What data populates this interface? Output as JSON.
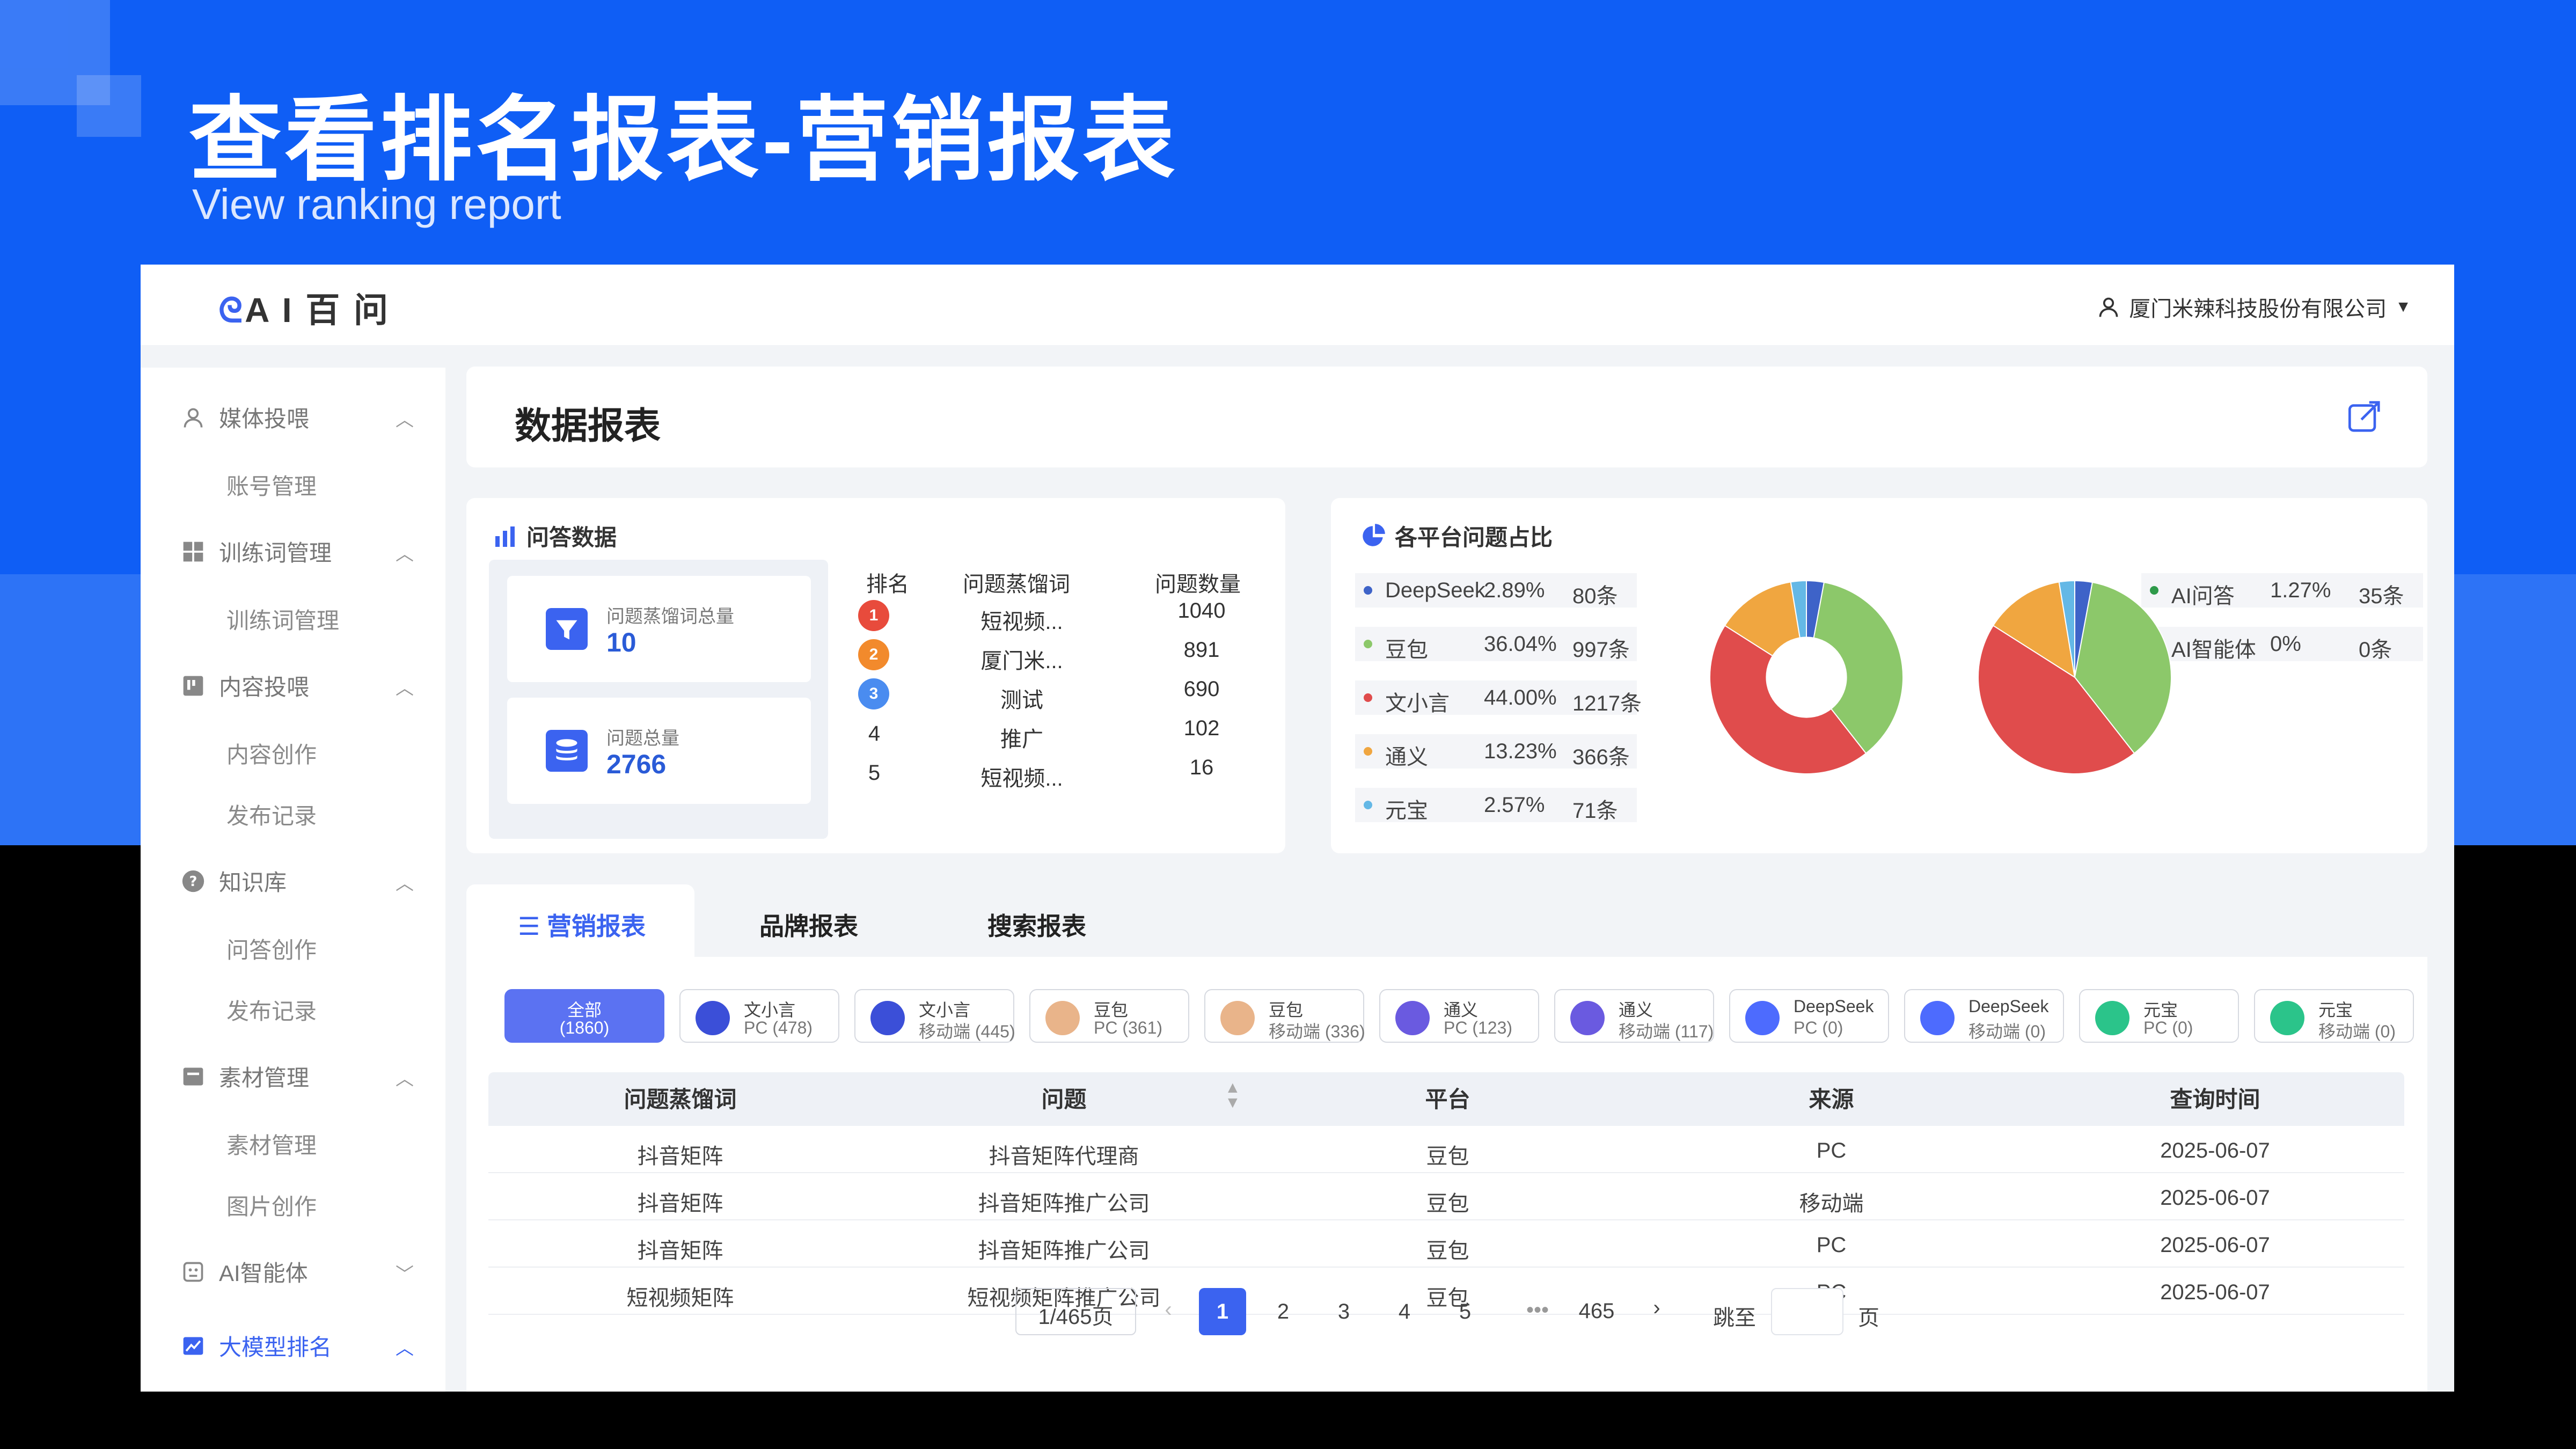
{
  "slide": {
    "title": "查看排名报表-营销报表",
    "subtitle": "View ranking report"
  },
  "app": {
    "logo_mark": "ᘓ",
    "logo_text": "A I 百 问",
    "company": "厦门米辣科技股份有限公司"
  },
  "sidebar": {
    "groups": [
      {
        "label": "媒体投喂",
        "icon": "user-icon",
        "items": [
          "账号管理"
        ]
      },
      {
        "label": "训练词管理",
        "icon": "grid-icon",
        "items": [
          "训练词管理"
        ]
      },
      {
        "label": "内容投喂",
        "icon": "board-icon",
        "items": [
          "内容创作",
          "发布记录"
        ]
      },
      {
        "label": "知识库",
        "icon": "question-icon",
        "items": [
          "问答创作",
          "发布记录"
        ]
      },
      {
        "label": "素材管理",
        "icon": "folder-icon",
        "items": [
          "素材管理",
          "图片创作"
        ]
      },
      {
        "label": "AI智能体",
        "icon": "robot-icon",
        "items": []
      },
      {
        "label": "大模型排名",
        "icon": "chart-icon",
        "items": [],
        "active": true
      }
    ]
  },
  "header": {
    "title": "数据报表"
  },
  "qa": {
    "title": "问答数据",
    "stats": [
      {
        "label": "问题蒸馏词总量",
        "value": "10"
      },
      {
        "label": "问题总量",
        "value": "2766"
      }
    ],
    "columns": [
      "排名",
      "问题蒸馏词",
      "问题数量"
    ],
    "rows": [
      {
        "rank": "1",
        "word": "短视频...",
        "count": "1040"
      },
      {
        "rank": "2",
        "word": "厦门米...",
        "count": "891"
      },
      {
        "rank": "3",
        "word": "测试",
        "count": "690"
      },
      {
        "rank": "4",
        "word": "推广",
        "count": "102"
      },
      {
        "rank": "5",
        "word": "短视频...",
        "count": "16"
      }
    ]
  },
  "platform": {
    "title": "各平台问题占比",
    "legend": [
      {
        "name": "DeepSeek",
        "pct": "2.89%",
        "count": "80条",
        "color": "#3e63c8"
      },
      {
        "name": "豆包",
        "pct": "36.04%",
        "count": "997条",
        "color": "#8cc86a"
      },
      {
        "name": "文小言",
        "pct": "44.00%",
        "count": "1217条",
        "color": "#e04c4c"
      },
      {
        "name": "通义",
        "pct": "13.23%",
        "count": "366条",
        "color": "#f0a640"
      },
      {
        "name": "元宝",
        "pct": "2.57%",
        "count": "71条",
        "color": "#64b8e6"
      }
    ],
    "legend2": [
      {
        "name": "AI问答",
        "pct": "1.27%",
        "count": "35条",
        "color": "#2e9a4a"
      },
      {
        "name": "AI智能体",
        "pct": "0%",
        "count": "0条",
        "color": "#9b9b9b"
      }
    ]
  },
  "chart_data": [
    {
      "type": "pie",
      "variant": "donut",
      "categories": [
        "DeepSeek",
        "豆包",
        "文小言",
        "通义",
        "元宝"
      ],
      "values": [
        2.89,
        36.04,
        44.0,
        13.23,
        2.57
      ],
      "colors": [
        "#3e63c8",
        "#8cc86a",
        "#e04c4c",
        "#f0a640",
        "#64b8e6"
      ]
    },
    {
      "type": "pie",
      "categories": [
        "DeepSeek",
        "豆包",
        "文小言",
        "通义",
        "元宝"
      ],
      "values": [
        2.89,
        36.04,
        44.0,
        13.23,
        2.57
      ],
      "colors": [
        "#3e63c8",
        "#8cc86a",
        "#e04c4c",
        "#f0a640",
        "#64b8e6"
      ]
    }
  ],
  "tabs": [
    {
      "label": "营销报表",
      "active": true
    },
    {
      "label": "品牌报表"
    },
    {
      "label": "搜索报表"
    }
  ],
  "filters": [
    {
      "name": "全部",
      "sub": "(1860)",
      "icon": "",
      "active": true
    },
    {
      "name": "文小言",
      "sub": "PC (478)",
      "icon": "wenxiaoyan-icon",
      "color": "#3b4fd8"
    },
    {
      "name": "文小言",
      "sub": "移动端 (445)",
      "icon": "wenxiaoyan-icon",
      "color": "#3b4fd8"
    },
    {
      "name": "豆包",
      "sub": "PC (361)",
      "icon": "doubao-icon",
      "color": "#e9b48a"
    },
    {
      "name": "豆包",
      "sub": "移动端 (336)",
      "icon": "doubao-icon",
      "color": "#e9b48a"
    },
    {
      "name": "通义",
      "sub": "PC (123)",
      "icon": "tongyi-icon",
      "color": "#6a5ae0"
    },
    {
      "name": "通义",
      "sub": "移动端 (117)",
      "icon": "tongyi-icon",
      "color": "#6a5ae0"
    },
    {
      "name": "DeepSeek",
      "sub": "PC (0)",
      "icon": "deepseek-icon",
      "color": "#4d6bfe"
    },
    {
      "name": "DeepSeek",
      "sub": "移动端 (0)",
      "icon": "deepseek-icon",
      "color": "#4d6bfe"
    },
    {
      "name": "元宝",
      "sub": "PC (0)",
      "icon": "yuanbao-icon",
      "color": "#2bc48a"
    },
    {
      "name": "元宝",
      "sub": "移动端 (0)",
      "icon": "yuanbao-icon",
      "color": "#2bc48a"
    }
  ],
  "table": {
    "columns": [
      "问题蒸馏词",
      "问题",
      "平台",
      "来源",
      "查询时间"
    ],
    "rows": [
      [
        "抖音矩阵",
        "抖音矩阵代理商",
        "豆包",
        "PC",
        "2025-06-07"
      ],
      [
        "抖音矩阵",
        "抖音矩阵推广公司",
        "豆包",
        "移动端",
        "2025-06-07"
      ],
      [
        "抖音矩阵",
        "抖音矩阵推广公司",
        "豆包",
        "PC",
        "2025-06-07"
      ],
      [
        "短视频矩阵",
        "短视频矩阵推广公司",
        "豆包",
        "PC",
        "2025-06-07"
      ]
    ]
  },
  "pagination": {
    "summary": "1/465页",
    "pages": [
      "1",
      "2",
      "3",
      "4",
      "5"
    ],
    "ellipsis": "•••",
    "last": "465",
    "jump_label": "跳至",
    "page_unit": "页",
    "current": 1
  }
}
